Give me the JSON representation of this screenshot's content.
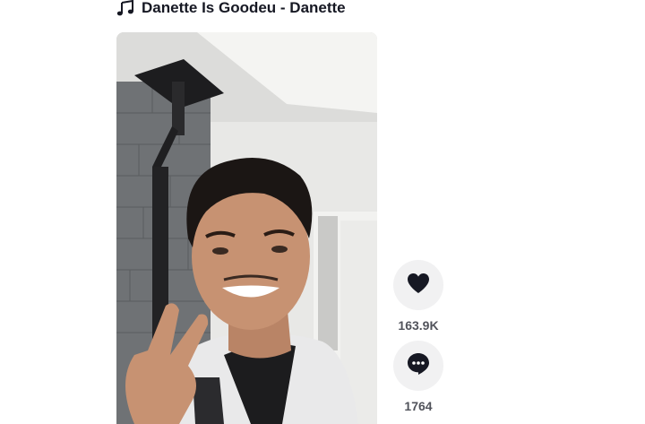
{
  "post": {
    "music_label": "Danette Is Goodeu - Danette",
    "music_icon": "music-note-icon"
  },
  "video": {
    "thumbnail_icon": "video-thumbnail"
  },
  "actions": {
    "like": {
      "icon": "heart-icon",
      "count": "163.9K"
    },
    "comment": {
      "icon": "comment-bubble-icon",
      "count": "1764"
    }
  }
}
